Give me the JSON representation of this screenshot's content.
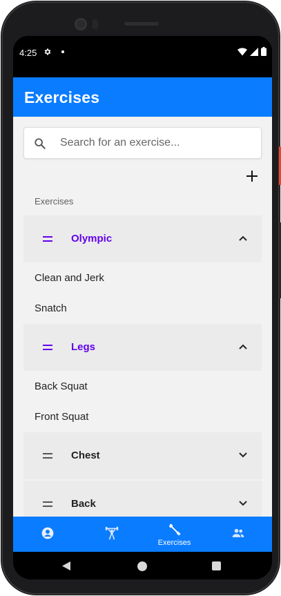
{
  "status_bar": {
    "time": "4:25"
  },
  "app_bar": {
    "title": "Exercises"
  },
  "search": {
    "placeholder": "Search for an exercise...",
    "value": ""
  },
  "list": {
    "section_label": "Exercises",
    "groups": [
      {
        "name": "Olympic",
        "expanded": true,
        "exercises": [
          "Clean and Jerk",
          "Snatch"
        ]
      },
      {
        "name": "Legs",
        "expanded": true,
        "exercises": [
          "Back Squat",
          "Front Squat"
        ]
      },
      {
        "name": "Chest",
        "expanded": false,
        "exercises": []
      },
      {
        "name": "Back",
        "expanded": false,
        "exercises": []
      }
    ]
  },
  "bottom_nav": {
    "items": [
      {
        "icon": "account-circle-icon",
        "label": ""
      },
      {
        "icon": "weightlifter-icon",
        "label": ""
      },
      {
        "icon": "dumbbell-icon",
        "label": "Exercises",
        "active": true
      },
      {
        "icon": "people-icon",
        "label": ""
      }
    ]
  },
  "colors": {
    "primary": "#0a7cff",
    "accent": "#6200ee",
    "background": "#f2f2f2",
    "group_header": "#ebebeb"
  }
}
